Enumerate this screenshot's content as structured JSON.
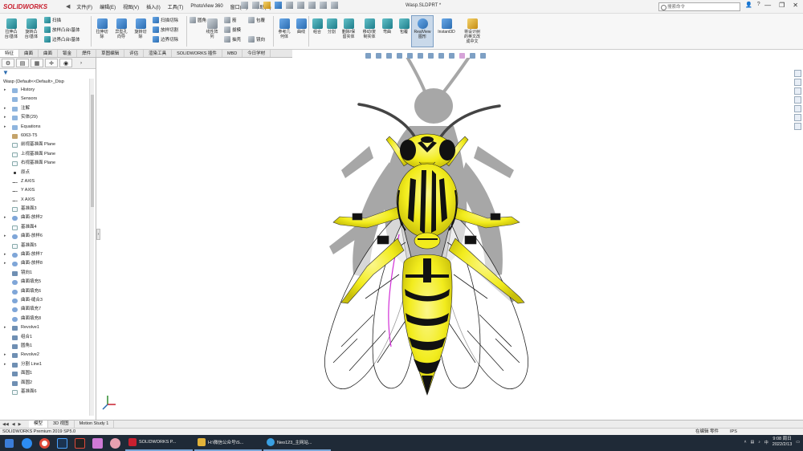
{
  "app": {
    "brand": "SOLIDWORKS",
    "window_title": "Wasp.SLDPRT *",
    "menus": [
      "文件(F)",
      "编辑(E)",
      "视图(V)",
      "插入(I)",
      "工具(T)",
      "PhotoView 360",
      "窗口(W)",
      "帮助(H)"
    ],
    "search_placeholder": "搜索命令",
    "window_controls": [
      "—",
      "❐",
      "✕"
    ]
  },
  "command_manager": {
    "large": [
      {
        "label": "拉伸凸\n台/基体"
      },
      {
        "label": "旋转凸\n台/基体"
      },
      {
        "label": "拉伸切\n除"
      },
      {
        "label": "异型孔\n向导"
      },
      {
        "label": "旋转切\n除"
      },
      {
        "label": "线性阵\n列"
      },
      {
        "label": "参考几\n何体"
      },
      {
        "label": "曲线"
      },
      {
        "label": "组合"
      },
      {
        "label": "分割"
      },
      {
        "label": "删除/保\n留实体"
      },
      {
        "label": "移动/复\n制实体"
      },
      {
        "label": "弯曲"
      },
      {
        "label": "包覆"
      },
      {
        "label": "RealView\n图形"
      },
      {
        "label": "Instant3D"
      },
      {
        "label": "将设计树\n的英文改\n成中文"
      }
    ],
    "small_group1": [
      "扫描",
      "放样凸台/基体",
      "边界凸台/基体"
    ],
    "small_group2": [
      "扫描切除",
      "放样切割",
      "边界切除"
    ],
    "small_group3": [
      "圆角",
      "拔模",
      "抽壳"
    ],
    "small_group4": [
      "筋",
      "包覆",
      "镜向"
    ]
  },
  "tabs": [
    "特征",
    "曲面",
    "曲面",
    "钣金",
    "焊件",
    "草图编辑",
    "评估",
    "渲染工具",
    "SOLIDWORKS 插件",
    "MBD",
    "今日学材"
  ],
  "feature_tree": {
    "root": "Wasp  (Default<<Default>_Disp",
    "items": [
      {
        "label": "History",
        "icon": "folder",
        "exp": "▸"
      },
      {
        "label": "Sensors",
        "icon": "folder",
        "exp": ""
      },
      {
        "label": "注解",
        "icon": "folder",
        "exp": "▸"
      },
      {
        "label": "实体(29)",
        "icon": "folder",
        "exp": "▸"
      },
      {
        "label": "Equations",
        "icon": "folder",
        "exp": "▸"
      },
      {
        "label": "6063-T5",
        "icon": "mat",
        "exp": ""
      },
      {
        "label": "前视基准面 Plane",
        "icon": "plane",
        "exp": ""
      },
      {
        "label": "上视基准面 Plane",
        "icon": "plane",
        "exp": ""
      },
      {
        "label": "右视基准面 Plane",
        "icon": "plane",
        "exp": ""
      },
      {
        "label": "原点",
        "icon": "pt",
        "exp": ""
      },
      {
        "label": "Z AXIS",
        "icon": "axis",
        "exp": ""
      },
      {
        "label": "Y AXIS",
        "icon": "axis",
        "exp": ""
      },
      {
        "label": "X AXIS",
        "icon": "axis",
        "exp": ""
      },
      {
        "label": "基准面3",
        "icon": "plane",
        "exp": ""
      },
      {
        "label": "曲面-放样2",
        "icon": "surf",
        "exp": "▸"
      },
      {
        "label": "基准面4",
        "icon": "plane",
        "exp": ""
      },
      {
        "label": "曲面-放样6",
        "icon": "surf",
        "exp": "▸"
      },
      {
        "label": "基准面5",
        "icon": "plane",
        "exp": ""
      },
      {
        "label": "曲面-放样7",
        "icon": "surf",
        "exp": "▸"
      },
      {
        "label": "曲面-放样8",
        "icon": "surf",
        "exp": "▸"
      },
      {
        "label": "镜向1",
        "icon": "feat",
        "exp": ""
      },
      {
        "label": "曲面填充5",
        "icon": "surf",
        "exp": ""
      },
      {
        "label": "曲面填充6",
        "icon": "surf",
        "exp": ""
      },
      {
        "label": "曲面-缝合3",
        "icon": "surf",
        "exp": ""
      },
      {
        "label": "曲面填充7",
        "icon": "surf",
        "exp": ""
      },
      {
        "label": "曲面填充8",
        "icon": "surf",
        "exp": ""
      },
      {
        "label": "Revolve1",
        "icon": "feat",
        "exp": "▸"
      },
      {
        "label": "组合1",
        "icon": "feat",
        "exp": ""
      },
      {
        "label": "圆角1",
        "icon": "feat",
        "exp": ""
      },
      {
        "label": "Revolve2",
        "icon": "feat",
        "exp": "▸"
      },
      {
        "label": "分割 Line1",
        "icon": "feat",
        "exp": "▸"
      },
      {
        "label": "面圆1",
        "icon": "feat",
        "exp": ""
      },
      {
        "label": "面圆2",
        "icon": "feat",
        "exp": ""
      },
      {
        "label": "基准面6",
        "icon": "plane",
        "exp": ""
      }
    ]
  },
  "bottom_tabs": [
    "模型",
    "3D 视图",
    "Motion Study 1"
  ],
  "status": {
    "left": "SOLIDWORKS Premium 2019 SP5.0",
    "mode": "在编辑 零件",
    "units": "IPS"
  },
  "taskbar": {
    "apps": [
      {
        "label": "SOLIDWORKS P...",
        "color": "#c8202f"
      },
      {
        "label": "H:\\微信公众号\\S...",
        "color": "#e2b33a"
      },
      {
        "label": "Neo123_主网站...",
        "color": "#3aa0e2"
      }
    ],
    "time": "9:08 周日",
    "date": "2022/2/13"
  },
  "colors": {
    "wasp_yellow": "#f2ec1d",
    "wasp_black": "#111111",
    "highlight": "#d12fd6"
  }
}
